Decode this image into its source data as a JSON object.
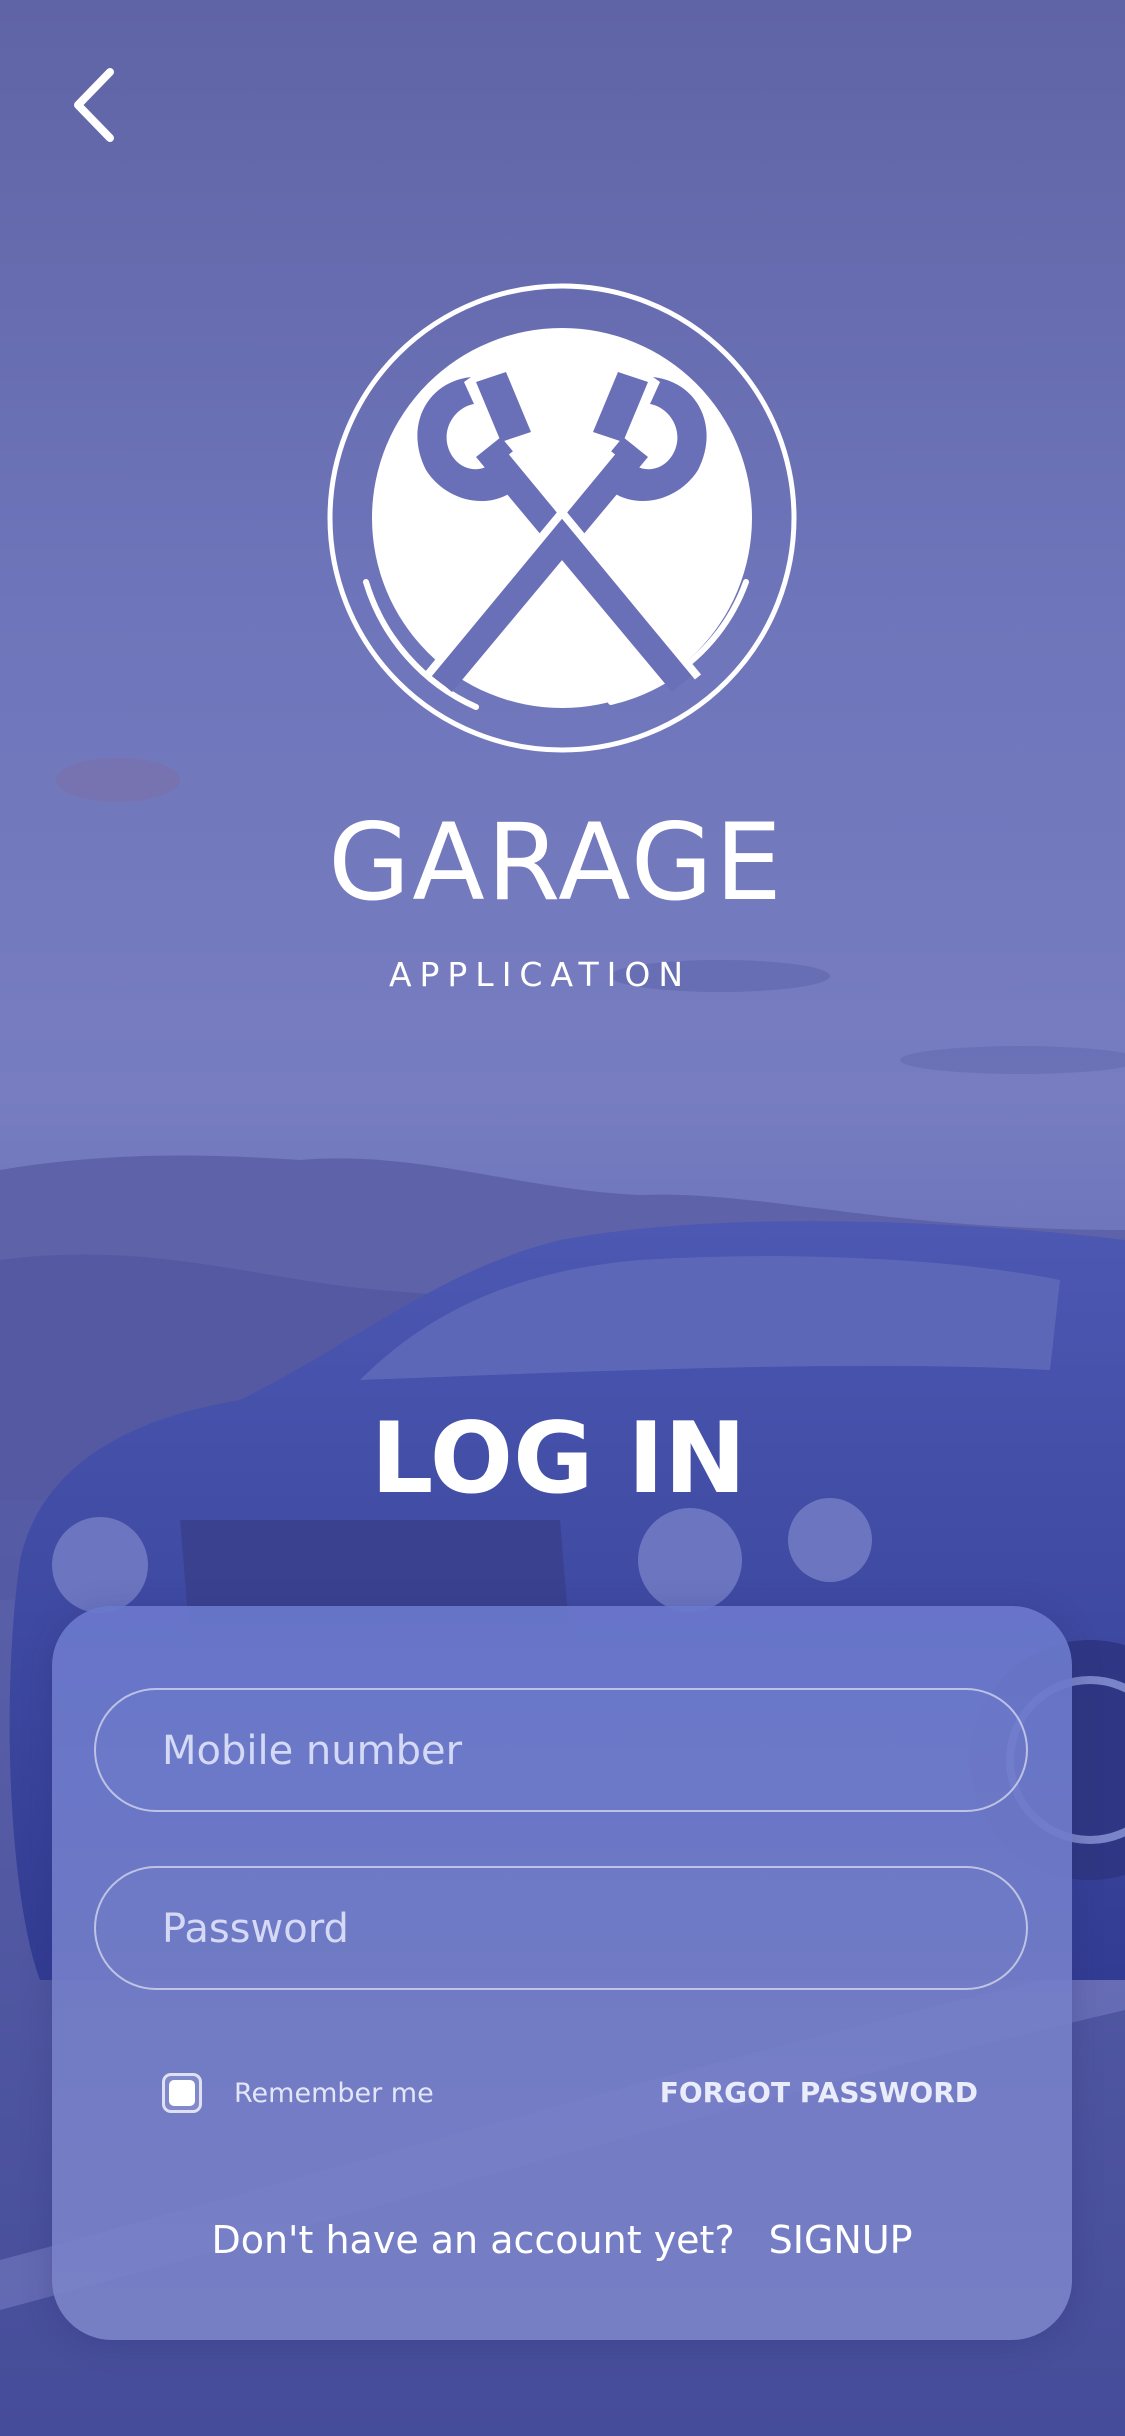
{
  "app": {
    "brand_title": "GARAGE",
    "brand_subtitle": "APPLICATION"
  },
  "header": {
    "back_icon": "chevron-left-icon"
  },
  "logo": {
    "icon": "crossed-wrenches-icon"
  },
  "login": {
    "title": "LOG IN",
    "mobile_placeholder": "Mobile number",
    "mobile_value": "",
    "password_placeholder": "Password",
    "password_value": "",
    "remember_label": "Remember me",
    "remember_checked": true,
    "forgot_label": "FORGOT PASSWORD",
    "signup_prompt": "Don't have an account yet?",
    "signup_label": "SIGNUP"
  },
  "colors": {
    "overlay": "#6a70b8",
    "text": "#ffffff"
  }
}
